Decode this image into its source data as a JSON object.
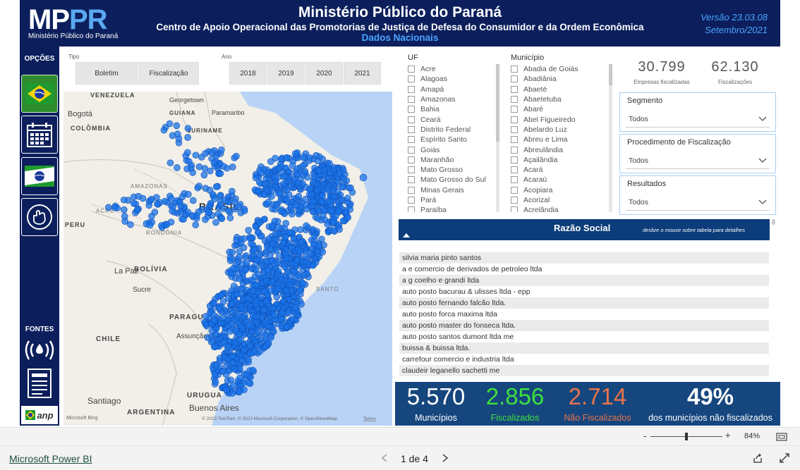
{
  "header": {
    "logo_main_a": "MP",
    "logo_main_b": "PR",
    "logo_sub": "Ministério Público do Paraná",
    "title": "Ministério Público do Paraná",
    "subtitle": "Centro de Apoio Operacional das Promotorias de Justiça de Defesa do Consumidor e da Ordem Econômica",
    "subtitle2": "Dados Nacionais",
    "version": "Versão 23.03.08",
    "date": "Setembro/2021"
  },
  "sidebar": {
    "options_label": "OPÇÕES",
    "sources_label": "FONTES",
    "buttons": [
      "brazil-flag-icon",
      "calendar-icon",
      "parana-flag-icon",
      "hand-icon"
    ],
    "source_buttons": [
      "signal-icon",
      "document-icon"
    ],
    "anp_label": "anp"
  },
  "filters": {
    "tipo_label": "Tipo",
    "tipo_options": [
      "Boletim",
      "Fiscalização"
    ],
    "ano_label": "Ano",
    "ano_options": [
      "2018",
      "2019",
      "2020",
      "2021"
    ]
  },
  "map": {
    "labels": {
      "venezuela": "VENEZUELA",
      "georgetown": "Georgetown",
      "bogota": "Bogotá",
      "guiana": "GUIANA",
      "paramaribo": "Paramaribo",
      "colombia": "COLÔMBIA",
      "suriname": "SURINAME",
      "amazonas": "AMAZONAS",
      "brasil": "BRASIL",
      "acre": "ACRE",
      "peru": "PERU",
      "rondonia": "RONDÔNIA",
      "lapaz": "La Paz",
      "bolivia": "BOLÍVIA",
      "sucre": "Sucre",
      "santo": "SANTO",
      "paragu": "PARAGU",
      "assuncao": "Assunção",
      "chile": "CHILE",
      "urugua": "URUGUA",
      "santiago": "Santiago",
      "argentina": "ARGENTINA",
      "buenos": "Buenos Aires"
    },
    "bing": "Microsoft Bing",
    "copyright": "© 2023 TomTom, © 2023 Microsoft Corporation, © OpenStreetMap",
    "terms": "Terms",
    "dot_color": "#1a73e8"
  },
  "uf": {
    "label": "UF",
    "items": [
      "Acre",
      "Alagoas",
      "Amapá",
      "Amazonas",
      "Bahia",
      "Ceará",
      "Distrito Federal",
      "Espírito Santo",
      "Goiás",
      "Maranhão",
      "Mato Grosso",
      "Mato Grosso do Sul",
      "Minas Gerais",
      "Pará",
      "Paraíba"
    ]
  },
  "municipio": {
    "label": "Município",
    "items": [
      "Abadia de Goiás",
      "Abadiânia",
      "Abaeté",
      "Abaetetuba",
      "Abaré",
      "Abel Figueiredo",
      "Abelardo Luz",
      "Abreu e Lima",
      "Abreulândia",
      "Açailândia",
      "Acará",
      "Acaraú",
      "Acopiara",
      "Acorizal",
      "Acrelândia"
    ]
  },
  "kpis_top": {
    "empresas_value": "30.799",
    "empresas_label": "Empresas fiscalizadas",
    "fiscalizacoes_value": "62.130",
    "fiscalizacoes_label": "Fiscalizações"
  },
  "dropdowns": [
    {
      "title": "Segmento",
      "value": "Todos"
    },
    {
      "title": "Procedimento de Fiscalização",
      "value": "Todos"
    },
    {
      "title": "Resultados",
      "value": "Todos"
    }
  ],
  "table": {
    "title": "Razão Social",
    "hint": "deslize o mouse sobre tabela para detalhes",
    "rows": [
      "silvia maria pinto santos",
      "a e comercio de derivados de petroleo ltda",
      "a g coelho e grandi ltda",
      "auto posto bacurau & ulisses ltda - epp",
      "auto posto fernando falcão ltda.",
      "auto posto forca maxima ltda",
      "auto posto master do fonseca ltda.",
      "auto posto santos dumont ltda me",
      "buissa & buissa ltda.",
      "carrefour comercio e industria ltda",
      "claudeir leganello sachetti me"
    ]
  },
  "kpis_bottom": [
    {
      "value": "5.570",
      "label": "Municípios",
      "color": "#ffffff"
    },
    {
      "value": "2.856",
      "label": "Fiscalizados",
      "color": "#3ee03e"
    },
    {
      "value": "2.714",
      "label": "Não Fiscalizados",
      "color": "#e8744a"
    },
    {
      "value": "49%",
      "label": "dos municípios não fiscalizados",
      "color": "#ffffff"
    }
  ],
  "zoom": {
    "minus": "-",
    "plus": "+",
    "value": "84%",
    "level": 0.5
  },
  "footer": {
    "brand": "Microsoft Power BI",
    "page": "1 de 4"
  }
}
